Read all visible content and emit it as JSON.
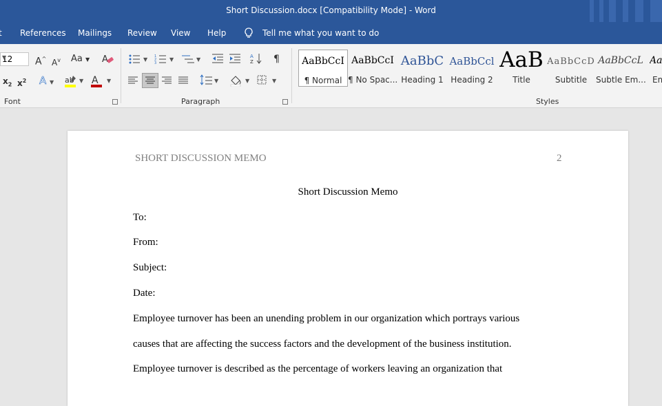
{
  "window": {
    "title": "Short Discussion.docx [Compatibility Mode]  -  Word"
  },
  "menu": {
    "items": [
      "References",
      "Mailings",
      "Review",
      "View",
      "Help"
    ],
    "tell_me": "Tell me what you want to do"
  },
  "ribbon": {
    "font": {
      "size": "12",
      "label": "Font",
      "grow": "A",
      "shrink": "A",
      "case": "Aa",
      "subscript": "x",
      "superscript": "x",
      "text_effects": "A",
      "font_color": "A"
    },
    "paragraph": {
      "label": "Paragraph"
    },
    "styles": {
      "label": "Styles",
      "items": [
        {
          "preview": "AaBbCcI",
          "name": "¶ Normal"
        },
        {
          "preview": "AaBbCcI",
          "name": "¶ No Spac..."
        },
        {
          "preview": "AaBbC",
          "name": "Heading 1"
        },
        {
          "preview": "AaBbCcl",
          "name": "Heading 2"
        },
        {
          "preview": "AaB",
          "name": "Title"
        },
        {
          "preview": "AaBbCcD",
          "name": "Subtitle"
        },
        {
          "preview": "AaBbCcL",
          "name": "Subtle Em..."
        },
        {
          "preview": "Aa",
          "name": "Em"
        }
      ]
    },
    "colors": {
      "highlight": "#ffff00",
      "font_color": "#c00000"
    }
  },
  "document": {
    "header": "SHORT DISCUSSION MEMO",
    "page_number": "2",
    "title": "Short Discussion Memo",
    "lines": [
      "To:",
      "From:",
      "Subject:",
      "Date:",
      "Employee turnover has been an unending problem in our organization which portrays various",
      "causes that are affecting the success factors and the development of the business institution.",
      "Employee turnover is described as the percentage of workers leaving an organization that"
    ]
  }
}
